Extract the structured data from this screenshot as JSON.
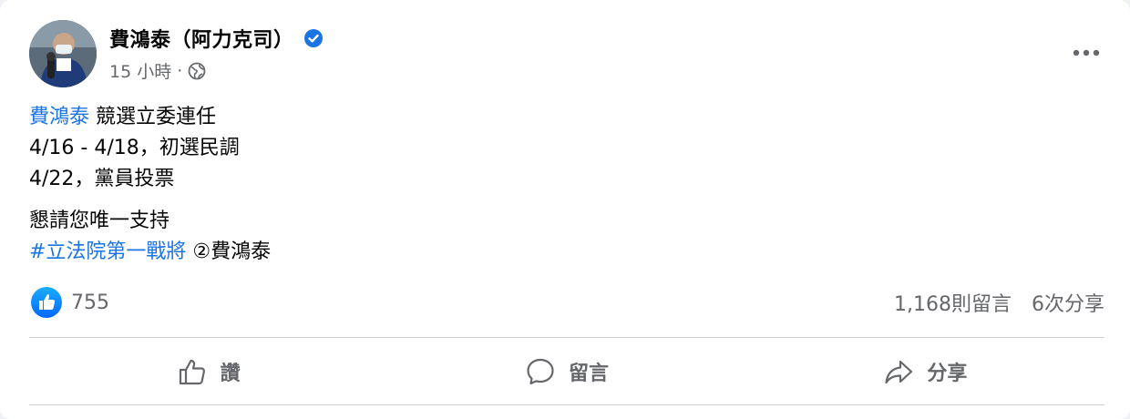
{
  "post": {
    "author": "費鴻泰（阿力克司）",
    "time": "15 小時",
    "meta_sep": "·",
    "lines": {
      "l1_link": "費鴻泰",
      "l1_rest": " 競選立委連任",
      "l2": "4/16 - 4/18，初選民調",
      "l3": "4/22，黨員投票",
      "l4": "懇請您唯一支持",
      "hashtag": "#立法院第一戰將",
      "l5_rest": " ②費鴻泰"
    }
  },
  "stats": {
    "likes": "755",
    "comments": "1,168則留言",
    "shares": "6次分享"
  },
  "actions": {
    "like": "讚",
    "comment": "留言",
    "share": "分享"
  },
  "icons": {
    "verified": "verified-badge-icon",
    "globe": "globe-icon",
    "more": "more-dots-icon",
    "like_badge": "like-badge-icon",
    "like": "thumbs-up-icon",
    "comment": "comment-bubble-icon",
    "share": "share-arrow-icon"
  },
  "colors": {
    "brand_blue": "#1b74e4",
    "secondary_text": "#65676b",
    "divider": "#ced0d4"
  }
}
